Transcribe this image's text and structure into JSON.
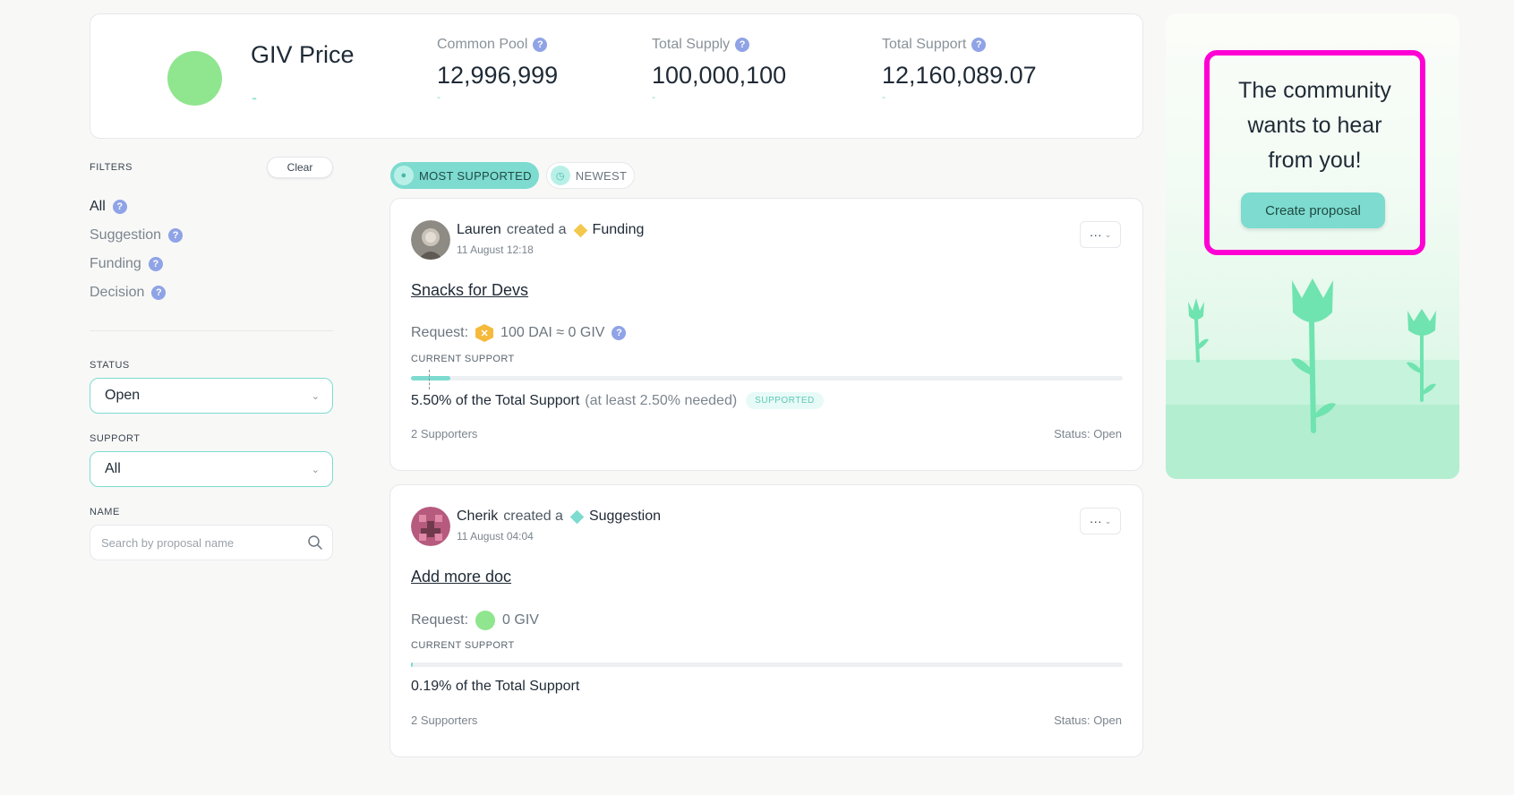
{
  "stats": {
    "giv_price": {
      "label": "GIV Price",
      "value": "-"
    },
    "common_pool": {
      "label": "Common Pool",
      "value": "12,996,999",
      "sub": "-"
    },
    "total_supply": {
      "label": "Total Supply",
      "value": "100,000,100",
      "sub": "-"
    },
    "total_support": {
      "label": "Total Support",
      "value": "12,160,089.07",
      "sub": "-"
    }
  },
  "filters": {
    "title": "FILTERS",
    "clear_label": "Clear",
    "items": [
      {
        "label": "All"
      },
      {
        "label": "Suggestion"
      },
      {
        "label": "Funding"
      },
      {
        "label": "Decision"
      }
    ],
    "status": {
      "label": "STATUS",
      "value": "Open"
    },
    "support": {
      "label": "SUPPORT",
      "value": "All"
    },
    "name": {
      "label": "NAME",
      "placeholder": "Search by proposal name"
    }
  },
  "sort_tabs": {
    "most_supported": "MOST SUPPORTED",
    "newest": "NEWEST"
  },
  "proposals": [
    {
      "author": "Lauren",
      "action": "created a",
      "type": "Funding",
      "type_color": "#f2c94c",
      "date": "11 August 12:18",
      "title": "Snacks for Devs",
      "request_label": "Request:",
      "request_value": "100 DAI ≈ 0 GIV",
      "current_support_label": "CURRENT SUPPORT",
      "support_fraction": 0.055,
      "threshold_fraction": 0.025,
      "support_text": "5.50% of the Total Support",
      "support_note": "(at least 2.50% needed)",
      "badge": "SUPPORTED",
      "supporters": "2 Supporters",
      "status": "Status: Open"
    },
    {
      "author": "Cherik",
      "action": "created a",
      "type": "Suggestion",
      "type_color": "#7ddbcf",
      "date": "11 August 04:04",
      "title": "Add more doc",
      "request_label": "Request:",
      "request_value": "0 GIV",
      "current_support_label": "CURRENT SUPPORT",
      "support_fraction": 0.0019,
      "support_text": "0.19% of the Total Support",
      "supporters": "2 Supporters",
      "status": "Status: Open"
    }
  ],
  "cta": {
    "message": "The community wants to hear from you!",
    "button_label": "Create proposal",
    "highlight_color": "#ff00d4"
  },
  "colors": {
    "accent": "#7ddbcf",
    "giv_green": "#90e58f",
    "help_blue": "#8fa3e6"
  }
}
